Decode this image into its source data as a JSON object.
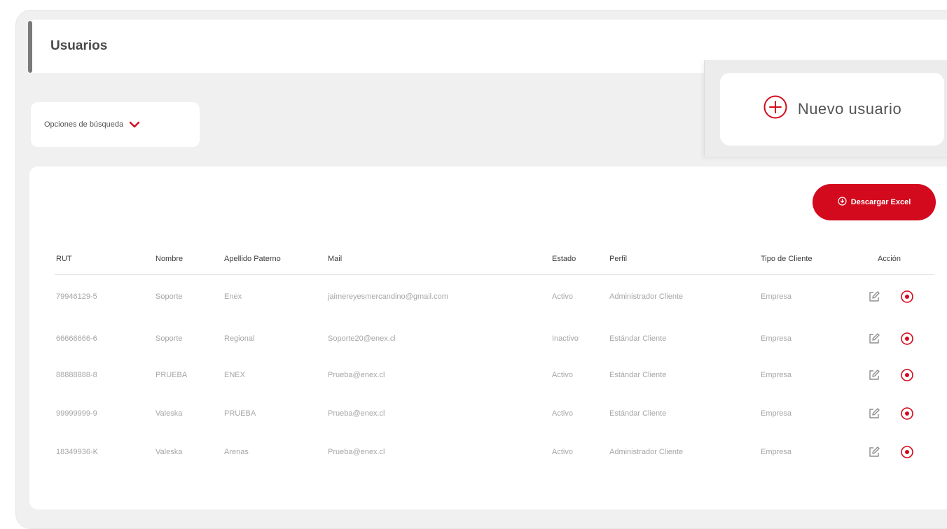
{
  "page": {
    "title": "Usuarios"
  },
  "search": {
    "label": "Opciones de búsqueda"
  },
  "actions": {
    "new_user": "Nuevo usuario",
    "download_excel": "Descargar Excel"
  },
  "table": {
    "columns": [
      "RUT",
      "Nombre",
      "Apellido Paterno",
      "Mail",
      "Estado",
      "Perfil",
      "Tipo de Cliente",
      "Acción"
    ],
    "rows": [
      {
        "rut": "79946129-5",
        "nombre": "Soporte",
        "apellido": "Enex",
        "mail": "jaimereyesmercandino@gmail.com",
        "estado": "Activo",
        "perfil": "Administrador Cliente",
        "tipo": "Empresa"
      },
      {
        "rut": "66666666-6",
        "nombre": "Soporte",
        "apellido": "Regional",
        "mail": "Soporte20@enex.cl",
        "estado": "Inactivo",
        "perfil": "Estándar Cliente",
        "tipo": "Empresa"
      },
      {
        "rut": "88888888-8",
        "nombre": "PRUEBA",
        "apellido": "ENEX",
        "mail": "Prueba@enex.cl",
        "estado": "Activo",
        "perfil": "Estándar Cliente",
        "tipo": "Empresa"
      },
      {
        "rut": "99999999-9",
        "nombre": "Valeska",
        "apellido": "PRUEBA",
        "mail": "Prueba@enex.cl",
        "estado": "Activo",
        "perfil": "Estándar Cliente",
        "tipo": "Empresa"
      },
      {
        "rut": "18349936-K",
        "nombre": "Valeska",
        "apellido": "Arenas",
        "mail": "Prueba@enex.cl",
        "estado": "Activo",
        "perfil": "Administrador Cliente",
        "tipo": "Empresa"
      }
    ]
  },
  "icons": {
    "search_toggle": "chevron-down-icon",
    "new_user": "plus-circle-icon",
    "download": "download-icon",
    "edit": "edit-icon",
    "delete": "delete-circle-icon"
  },
  "colors": {
    "accent": "#d30a1d",
    "background": "#f0f0f0",
    "card": "#ffffff",
    "muted_text": "#a6a6a6"
  }
}
